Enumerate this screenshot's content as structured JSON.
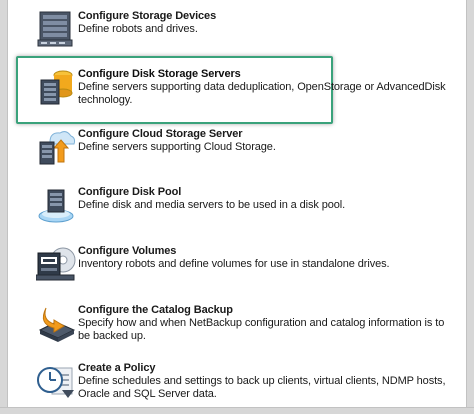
{
  "items": [
    {
      "title": "Configure Storage Devices",
      "description": "Define robots and drives.",
      "icon": "storage-devices-icon"
    },
    {
      "title": "Configure Disk Storage Servers",
      "description": "Define servers supporting data deduplication, OpenStorage or AdvancedDisk technology.",
      "icon": "disk-storage-server-icon",
      "selected": true
    },
    {
      "title": "Configure Cloud Storage Server",
      "description": "Define servers supporting Cloud Storage.",
      "icon": "cloud-storage-server-icon"
    },
    {
      "title": "Configure Disk Pool",
      "description": "Define disk and media servers to be used in a disk pool.",
      "icon": "disk-pool-icon"
    },
    {
      "title": "Configure Volumes",
      "description": "Inventory robots and define volumes for use in standalone drives.",
      "icon": "volumes-icon"
    },
    {
      "title": "Configure the Catalog Backup",
      "description": "Specify how and when NetBackup configuration and catalog information is to be backed up.",
      "icon": "catalog-backup-icon"
    },
    {
      "title": "Create a Policy",
      "description": "Define schedules and settings to back up clients, virtual clients, NDMP hosts, Oracle and SQL Server data.",
      "icon": "create-policy-icon"
    }
  ],
  "colors": {
    "highlight_border": "#3aa27b",
    "text": "#1a1a1a",
    "panel_border": "#d7d7d7"
  }
}
